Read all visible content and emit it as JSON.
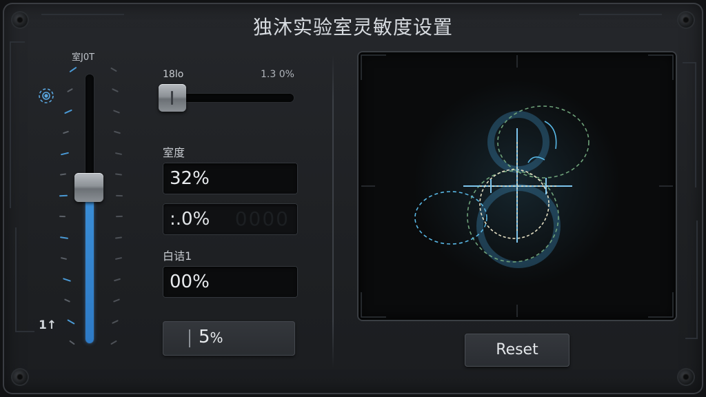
{
  "window": {
    "title": "独沐实验室灵敏度设置"
  },
  "vertical_slider": {
    "top_label": "室J0T",
    "bottom_label": "1↑",
    "level_fraction": 0.58,
    "accent_color": "#3b8fd8",
    "icon": "gear-icon"
  },
  "horizontal_slider": {
    "left_label": "18lo",
    "right_label": "1.3 0%",
    "level_fraction": 0.05
  },
  "fields": {
    "label_1": "室度",
    "value_1": "32%",
    "value_2": ":.0%",
    "label_2": "白诘1",
    "value_3": "00%"
  },
  "stepper": {
    "value": "5",
    "unit": "%"
  },
  "visualizer": {
    "colors": {
      "cyan": "#59b8e6",
      "green": "#6fa37a",
      "cream": "#e6e0c4"
    }
  },
  "actions": {
    "reset_label": "Reset"
  }
}
